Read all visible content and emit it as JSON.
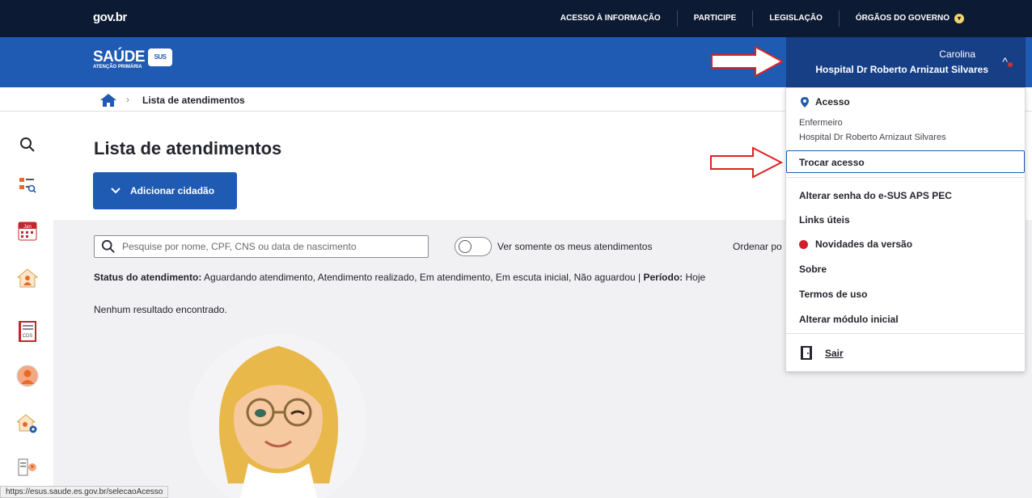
{
  "govbar": {
    "logo": "gov.br",
    "links": [
      "ACESSO À INFORMAÇÃO",
      "PARTICIPE",
      "LEGISLAÇÃO",
      "ÓRGÃOS DO GOVERNO"
    ]
  },
  "brand": {
    "name": "SAÚDE",
    "badge": "SUS",
    "subtitle": "ATENÇÃO PRIMÁRIA"
  },
  "user": {
    "name": "Carolina",
    "unit": "Hospital Dr Roberto Arnizaut Silvares"
  },
  "breadcrumb": {
    "current": "Lista de atendimentos"
  },
  "main": {
    "title": "Lista de atendimentos",
    "add_button": "Adicionar cidadão",
    "search_placeholder": "Pesquise por nome, CPF, CNS ou data de nascimento",
    "toggle_label": "Ver somente os meus atendimentos",
    "order_label": "Ordenar po",
    "status_label": "Status do atendimento:",
    "status_values": "Aguardando atendimento, Atendimento realizado, Em atendimento, Em escuta inicial, Não aguardou",
    "period_label": "Período:",
    "period_value": "Hoje",
    "empty": "Nenhum resultado encontrado."
  },
  "sidebar": {
    "calendar_label": "Jan",
    "cds_label": "CDS"
  },
  "menu": {
    "access_heading": "Acesso",
    "role": "Enfermeiro",
    "unit": "Hospital Dr Roberto Arnizaut Silvares",
    "switch_access": "Trocar acesso",
    "change_password": "Alterar senha do e-SUS APS PEC",
    "useful_links": "Links úteis",
    "release_notes": "Novidades da versão",
    "about": "Sobre",
    "terms": "Termos de uso",
    "initial_module": "Alterar módulo inicial",
    "logout": "Sair"
  },
  "status_bar_url": "https://esus.saude.es.gov.br/selecaoAcesso",
  "colors": {
    "gov_navy": "#0c1a33",
    "brand_blue": "#1f5bb3",
    "alert_red": "#d0202c"
  }
}
